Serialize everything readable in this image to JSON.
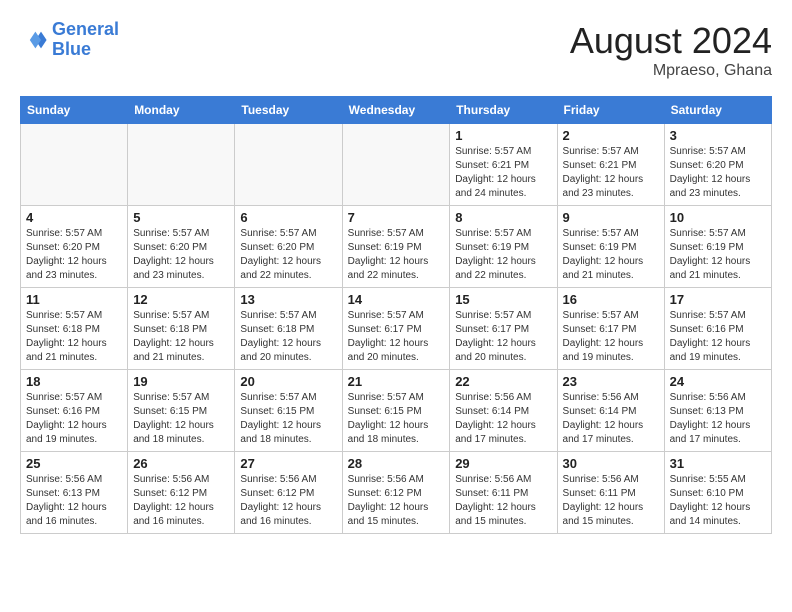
{
  "header": {
    "logo_line1": "General",
    "logo_line2": "Blue",
    "month_year": "August 2024",
    "location": "Mpraeso, Ghana"
  },
  "weekdays": [
    "Sunday",
    "Monday",
    "Tuesday",
    "Wednesday",
    "Thursday",
    "Friday",
    "Saturday"
  ],
  "weeks": [
    [
      {
        "day": "",
        "empty": true
      },
      {
        "day": "",
        "empty": true
      },
      {
        "day": "",
        "empty": true
      },
      {
        "day": "",
        "empty": true
      },
      {
        "day": "1",
        "sunrise": "5:57 AM",
        "sunset": "6:21 PM",
        "daylight": "12 hours and 24 minutes."
      },
      {
        "day": "2",
        "sunrise": "5:57 AM",
        "sunset": "6:21 PM",
        "daylight": "12 hours and 23 minutes."
      },
      {
        "day": "3",
        "sunrise": "5:57 AM",
        "sunset": "6:20 PM",
        "daylight": "12 hours and 23 minutes."
      }
    ],
    [
      {
        "day": "4",
        "sunrise": "5:57 AM",
        "sunset": "6:20 PM",
        "daylight": "12 hours and 23 minutes."
      },
      {
        "day": "5",
        "sunrise": "5:57 AM",
        "sunset": "6:20 PM",
        "daylight": "12 hours and 23 minutes."
      },
      {
        "day": "6",
        "sunrise": "5:57 AM",
        "sunset": "6:20 PM",
        "daylight": "12 hours and 22 minutes."
      },
      {
        "day": "7",
        "sunrise": "5:57 AM",
        "sunset": "6:19 PM",
        "daylight": "12 hours and 22 minutes."
      },
      {
        "day": "8",
        "sunrise": "5:57 AM",
        "sunset": "6:19 PM",
        "daylight": "12 hours and 22 minutes."
      },
      {
        "day": "9",
        "sunrise": "5:57 AM",
        "sunset": "6:19 PM",
        "daylight": "12 hours and 21 minutes."
      },
      {
        "day": "10",
        "sunrise": "5:57 AM",
        "sunset": "6:19 PM",
        "daylight": "12 hours and 21 minutes."
      }
    ],
    [
      {
        "day": "11",
        "sunrise": "5:57 AM",
        "sunset": "6:18 PM",
        "daylight": "12 hours and 21 minutes."
      },
      {
        "day": "12",
        "sunrise": "5:57 AM",
        "sunset": "6:18 PM",
        "daylight": "12 hours and 21 minutes."
      },
      {
        "day": "13",
        "sunrise": "5:57 AM",
        "sunset": "6:18 PM",
        "daylight": "12 hours and 20 minutes."
      },
      {
        "day": "14",
        "sunrise": "5:57 AM",
        "sunset": "6:17 PM",
        "daylight": "12 hours and 20 minutes."
      },
      {
        "day": "15",
        "sunrise": "5:57 AM",
        "sunset": "6:17 PM",
        "daylight": "12 hours and 20 minutes."
      },
      {
        "day": "16",
        "sunrise": "5:57 AM",
        "sunset": "6:17 PM",
        "daylight": "12 hours and 19 minutes."
      },
      {
        "day": "17",
        "sunrise": "5:57 AM",
        "sunset": "6:16 PM",
        "daylight": "12 hours and 19 minutes."
      }
    ],
    [
      {
        "day": "18",
        "sunrise": "5:57 AM",
        "sunset": "6:16 PM",
        "daylight": "12 hours and 19 minutes."
      },
      {
        "day": "19",
        "sunrise": "5:57 AM",
        "sunset": "6:15 PM",
        "daylight": "12 hours and 18 minutes."
      },
      {
        "day": "20",
        "sunrise": "5:57 AM",
        "sunset": "6:15 PM",
        "daylight": "12 hours and 18 minutes."
      },
      {
        "day": "21",
        "sunrise": "5:57 AM",
        "sunset": "6:15 PM",
        "daylight": "12 hours and 18 minutes."
      },
      {
        "day": "22",
        "sunrise": "5:56 AM",
        "sunset": "6:14 PM",
        "daylight": "12 hours and 17 minutes."
      },
      {
        "day": "23",
        "sunrise": "5:56 AM",
        "sunset": "6:14 PM",
        "daylight": "12 hours and 17 minutes."
      },
      {
        "day": "24",
        "sunrise": "5:56 AM",
        "sunset": "6:13 PM",
        "daylight": "12 hours and 17 minutes."
      }
    ],
    [
      {
        "day": "25",
        "sunrise": "5:56 AM",
        "sunset": "6:13 PM",
        "daylight": "12 hours and 16 minutes."
      },
      {
        "day": "26",
        "sunrise": "5:56 AM",
        "sunset": "6:12 PM",
        "daylight": "12 hours and 16 minutes."
      },
      {
        "day": "27",
        "sunrise": "5:56 AM",
        "sunset": "6:12 PM",
        "daylight": "12 hours and 16 minutes."
      },
      {
        "day": "28",
        "sunrise": "5:56 AM",
        "sunset": "6:12 PM",
        "daylight": "12 hours and 15 minutes."
      },
      {
        "day": "29",
        "sunrise": "5:56 AM",
        "sunset": "6:11 PM",
        "daylight": "12 hours and 15 minutes."
      },
      {
        "day": "30",
        "sunrise": "5:56 AM",
        "sunset": "6:11 PM",
        "daylight": "12 hours and 15 minutes."
      },
      {
        "day": "31",
        "sunrise": "5:55 AM",
        "sunset": "6:10 PM",
        "daylight": "12 hours and 14 minutes."
      }
    ]
  ]
}
